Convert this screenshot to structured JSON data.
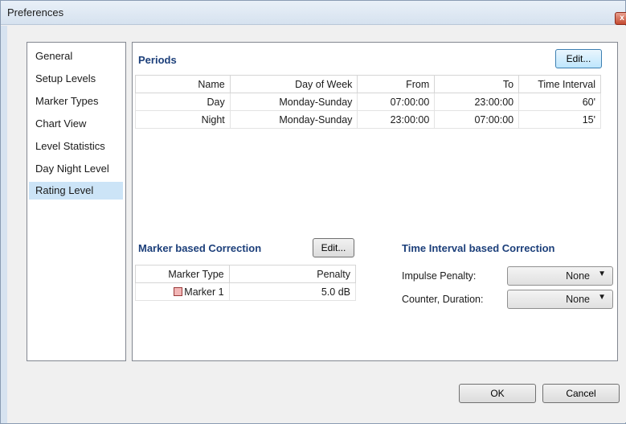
{
  "window": {
    "title": "Preferences",
    "close_glyph": "x"
  },
  "nav": {
    "items": [
      {
        "label": "General"
      },
      {
        "label": "Setup Levels"
      },
      {
        "label": "Marker Types"
      },
      {
        "label": "Chart View"
      },
      {
        "label": "Level Statistics"
      },
      {
        "label": "Day Night Level"
      },
      {
        "label": "Rating Level"
      }
    ],
    "selected": "Rating Level"
  },
  "periods": {
    "title": "Periods",
    "edit_label": "Edit...",
    "columns": [
      "Name",
      "Day of Week",
      "From",
      "To",
      "Time Interval"
    ],
    "rows": [
      [
        "Day",
        "Monday-Sunday",
        "07:00:00",
        "23:00:00",
        "60'"
      ],
      [
        "Night",
        "Monday-Sunday",
        "23:00:00",
        "07:00:00",
        "15'"
      ]
    ]
  },
  "marker_correction": {
    "title": "Marker based Correction",
    "edit_label": "Edit...",
    "columns": [
      "Marker Type",
      "Penalty"
    ],
    "rows": [
      {
        "marker": "Marker 1",
        "penalty": "5.0 dB",
        "swatch_color": "#f2b6b6"
      }
    ]
  },
  "interval_correction": {
    "title": "Time Interval based Correction",
    "impulse_label": "Impulse Penalty:",
    "impulse_value": "None",
    "counter_label": "Counter, Duration:",
    "counter_value": "None"
  },
  "footer": {
    "ok_label": "OK",
    "cancel_label": "Cancel"
  },
  "colors": {
    "accent": "#1c3f7a",
    "selection": "#cce4f7"
  }
}
